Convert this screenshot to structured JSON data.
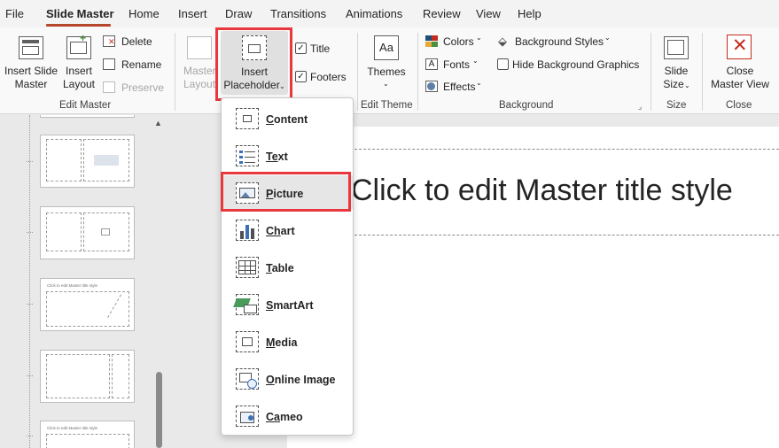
{
  "menu_tabs": [
    "File",
    "Slide Master",
    "Home",
    "Insert",
    "Draw",
    "Transitions",
    "Animations",
    "Review",
    "View",
    "Help"
  ],
  "active_tab": "Slide Master",
  "ribbon": {
    "insert_slide_master": [
      "Insert Slide",
      "Master"
    ],
    "insert_layout": [
      "Insert",
      "Layout"
    ],
    "delete": "Delete",
    "rename": "Rename",
    "preserve": "Preserve",
    "group_edit_master": "Edit Master",
    "master_layout": [
      "Master",
      "Layout"
    ],
    "insert_placeholder": [
      "Insert",
      "Placeholder"
    ],
    "title_check": "Title",
    "footers_check": "Footers",
    "themes": "Themes",
    "group_edit_theme": "Edit Theme",
    "colors": "Colors",
    "fonts": "Fonts",
    "effects": "Effects",
    "background_styles": "Background Styles",
    "hide_background_graphics": "Hide Background Graphics",
    "group_background": "Background",
    "slide_size": [
      "Slide",
      "Size"
    ],
    "group_size": "Size",
    "close_master_view": [
      "Close",
      "Master View"
    ],
    "group_close": "Close"
  },
  "dropdown": {
    "items": [
      {
        "label": "Content",
        "accel": "C",
        "rest": "ontent",
        "icon": "content-placeholder-icon"
      },
      {
        "label": "Text",
        "accel": "Te",
        "rest": "xt",
        "icon": "text-placeholder-icon"
      },
      {
        "label": "Picture",
        "accel": "P",
        "rest": "icture",
        "icon": "picture-placeholder-icon"
      },
      {
        "label": "Chart",
        "accel": "Ch",
        "rest": "art",
        "icon": "chart-placeholder-icon"
      },
      {
        "label": "Table",
        "accel": "T",
        "rest": "able",
        "icon": "table-placeholder-icon"
      },
      {
        "label": "SmartArt",
        "accel": "S",
        "rest": "martArt",
        "icon": "smartart-placeholder-icon"
      },
      {
        "label": "Media",
        "accel": "M",
        "rest": "edia",
        "icon": "media-placeholder-icon"
      },
      {
        "label": "Online Image",
        "accel": "O",
        "rest": "nline Image",
        "icon": "online-image-placeholder-icon"
      },
      {
        "label": "Cameo",
        "accel": "Ca",
        "rest": "meo",
        "icon": "cameo-placeholder-icon"
      }
    ]
  },
  "slide": {
    "title": "Click to edit Master title style"
  },
  "thumbnails": {
    "title_text": "Click to edit Master title style"
  },
  "colors": {
    "accent": "#b7472a",
    "highlight": "#e8383d"
  }
}
